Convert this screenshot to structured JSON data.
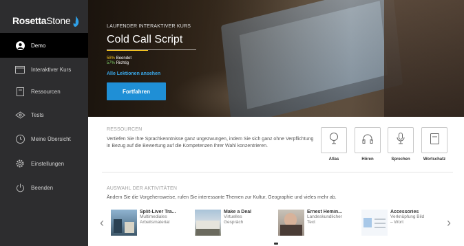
{
  "brand": {
    "name_bold": "Rosetta",
    "name_rest": "Stone"
  },
  "sidebar": {
    "items": [
      {
        "label": "Demo",
        "icon": "user-icon",
        "active": true
      },
      {
        "label": "Interaktiver Kurs",
        "icon": "course-icon"
      },
      {
        "label": "Ressourcen",
        "icon": "document-icon"
      },
      {
        "label": "Tests",
        "icon": "tests-icon"
      },
      {
        "label": "Meine Übersicht",
        "icon": "clock-icon"
      },
      {
        "label": "Einstellungen",
        "icon": "gear-icon"
      },
      {
        "label": "Beenden",
        "icon": "power-icon"
      }
    ]
  },
  "hero": {
    "kicker": "LAUFENDER INTERAKTIVER KURS",
    "title": "Cold Call Script",
    "stat1_pct": "58%",
    "stat1_label": "Beendet",
    "stat2_pct": "57%",
    "stat2_label": "Richtig",
    "link": "Alle Lektionen ansehen",
    "button": "Fortfahren"
  },
  "resources": {
    "title": "RESSOURCEN",
    "description": "Vertiefen Sie Ihre Sprachkenntnisse ganz ungezwungen, indem Sie sich ganz ohne Verpflichtung in Bezug auf die Bewertung auf die Kompetenzen Ihrer Wahl konzentrieren.",
    "tiles": [
      {
        "label": "Atlas",
        "icon": "pin-icon"
      },
      {
        "label": "Hören",
        "icon": "headphones-icon"
      },
      {
        "label": "Sprechen",
        "icon": "microphone-icon"
      },
      {
        "label": "Wortschatz",
        "icon": "book-icon"
      }
    ]
  },
  "activities": {
    "title": "AUSWAHL DER AKTIVITÄTEN",
    "description": "Ändern Sie die Vorgehensweise, rufen Sie interessante Themen zur Kultur, Geographie und vieles mehr ab.",
    "cards": [
      {
        "title": "Split-Liver Tra...",
        "sub1": "Multimediales",
        "sub2": "Arbeitsmaterial"
      },
      {
        "title": "Make a Deal",
        "sub1": "Virtuelles",
        "sub2": "Gespräch"
      },
      {
        "title": "Ernest Hemin...",
        "sub1": "Landeskundlicher",
        "sub2": "Text"
      },
      {
        "title": "Accessories",
        "sub1": "Verknüpfung Bild",
        "sub2": "– Wort"
      }
    ]
  },
  "colors": {
    "accent": "#1f8fd6",
    "sidebar": "#2d2d2f",
    "highlight": "#f0c020"
  }
}
